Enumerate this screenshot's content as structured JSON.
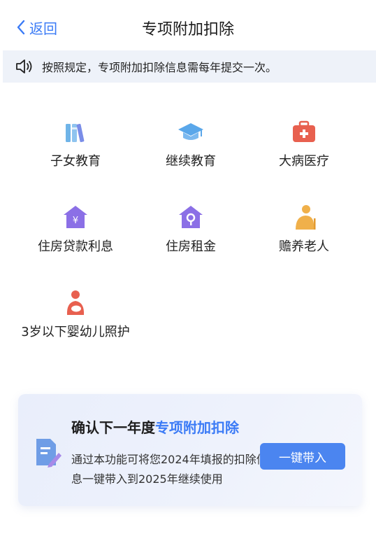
{
  "nav": {
    "back_label": "返回",
    "title": "专项附加扣除"
  },
  "notice": {
    "text": "按照规定，专项附加扣除信息需每年提交一次。"
  },
  "items": [
    {
      "label": "子女教育",
      "icon": "books-icon"
    },
    {
      "label": "继续教育",
      "icon": "graduation-cap-icon"
    },
    {
      "label": "大病医疗",
      "icon": "medical-kit-icon"
    },
    {
      "label": "住房贷款利息",
      "icon": "house-yen-icon"
    },
    {
      "label": "住房租金",
      "icon": "house-key-icon"
    },
    {
      "label": "赡养老人",
      "icon": "elderly-person-icon"
    },
    {
      "label": "3岁以下婴幼儿照护",
      "icon": "mother-child-icon"
    }
  ],
  "card": {
    "title_prefix": "确认下一年度",
    "title_highlight": "专项附加扣除",
    "desc": "通过本功能可将您2024年填报的扣除信息一键带入到2025年继续使用",
    "button": "一键带入"
  },
  "colors": {
    "accent": "#3b7bf6",
    "button": "#4b85f0",
    "notice_bg": "#eef2f9"
  }
}
